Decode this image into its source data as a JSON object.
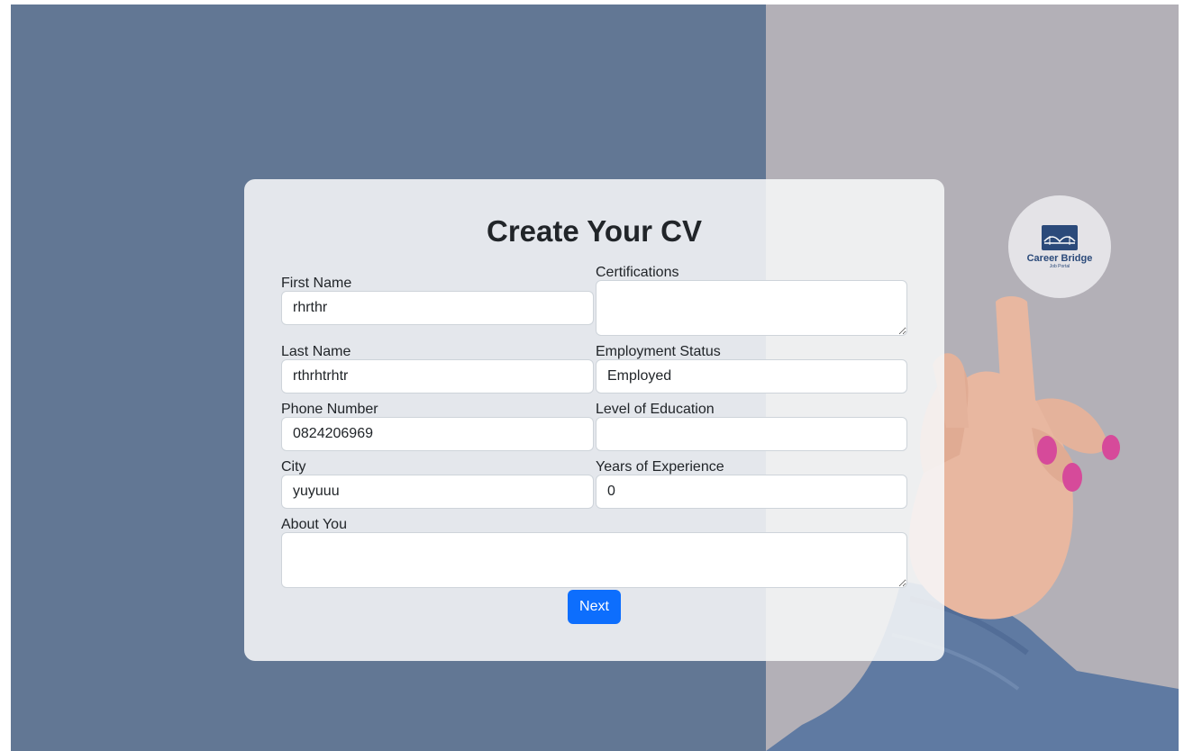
{
  "form": {
    "title": "Create Your CV",
    "first_name": {
      "label": "First Name",
      "value": "rhrthr"
    },
    "last_name": {
      "label": "Last Name",
      "value": "rthrhtrhtr"
    },
    "phone": {
      "label": "Phone Number",
      "value": "0824206969"
    },
    "city": {
      "label": "City",
      "value": "yuyuuu"
    },
    "about": {
      "label": "About You",
      "value": ""
    },
    "certifications": {
      "label": "Certifications",
      "value": ""
    },
    "employment_status": {
      "label": "Employment Status",
      "value": "Employed"
    },
    "education": {
      "label": "Level of Education",
      "value": ""
    },
    "experience": {
      "label": "Years of Experience",
      "value": "0"
    },
    "next_label": "Next"
  },
  "logo": {
    "name": "Career Bridge",
    "tagline": "Job Portal",
    "icon": "bridge-icon"
  },
  "colors": {
    "left_background": "#627794",
    "right_background": "#b3b0b7",
    "primary_button": "#0d6efd",
    "logo_text": "#2b4a7a"
  }
}
